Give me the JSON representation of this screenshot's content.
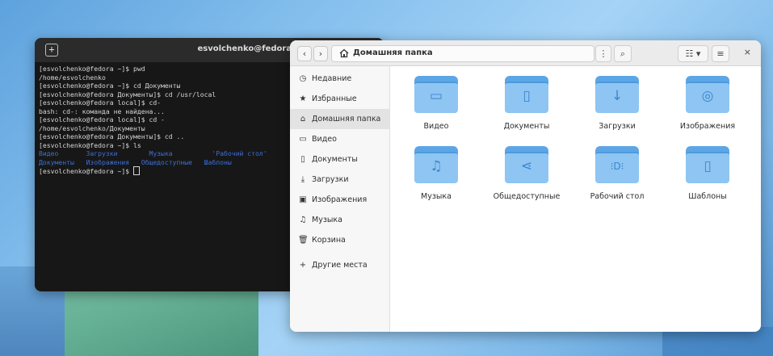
{
  "terminal": {
    "title": "esvolchenko@fedora:~",
    "new_tab_icon": "+",
    "lines": [
      "[esvolchenko@fedora ~]$ pwd",
      "/home/esvolchenko",
      "[esvolchenko@fedora ~]$ cd Документы",
      "[esvolchenko@fedora Документы]$ cd /usr/local",
      "[esvolchenko@fedora local]$ cd-",
      "bash: cd-: команда не найдена...",
      "[esvolchenko@fedora local]$ cd -",
      "/home/esvolchenko/Документы",
      "[esvolchenko@fedora Документы]$ cd ..",
      "[esvolchenko@fedora ~]$ ls"
    ],
    "ls_row1": "Видео       Загрузки        Музыка          'Рабочий стол'",
    "ls_row2": "Документы   Изображения   Общедоступные   Шаблоны",
    "prompt": "[esvolchenko@fedora ~]$ "
  },
  "files": {
    "path": "Домашняя папка",
    "sidebar": [
      {
        "label": "Недавние",
        "icon": "◷"
      },
      {
        "label": "Избранные",
        "icon": "★"
      },
      {
        "label": "Домашняя папка",
        "icon": "⌂"
      },
      {
        "label": "Видео",
        "icon": "▭"
      },
      {
        "label": "Документы",
        "icon": "▯"
      },
      {
        "label": "Загрузки",
        "icon": "⤓"
      },
      {
        "label": "Изображения",
        "icon": "▣"
      },
      {
        "label": "Музыка",
        "icon": "♫"
      },
      {
        "label": "Корзина",
        "icon": "🗑"
      },
      {
        "label": "Другие места",
        "icon": "+"
      }
    ],
    "folders": [
      {
        "label": "Видео",
        "glyph": "▭"
      },
      {
        "label": "Документы",
        "glyph": "▯"
      },
      {
        "label": "Загрузки",
        "glyph": "↓"
      },
      {
        "label": "Изображения",
        "glyph": "◎"
      },
      {
        "label": "Музыка",
        "glyph": "♫"
      },
      {
        "label": "Общедоступные",
        "glyph": "⋖"
      },
      {
        "label": "Рабочий стол",
        "glyph": "⁝D⁝"
      },
      {
        "label": "Шаблоны",
        "glyph": "▯"
      }
    ],
    "buttons": {
      "back": "‹",
      "forward": "›",
      "menu": "⋮",
      "search": "⌕",
      "view": "☷",
      "dropdown": "▾",
      "hamburger": "≡",
      "close": "×"
    }
  },
  "colors": {
    "folder_accent": "#5da6e6",
    "terminal_bg": "#171717",
    "ls_blue": "#3d6fd6"
  }
}
